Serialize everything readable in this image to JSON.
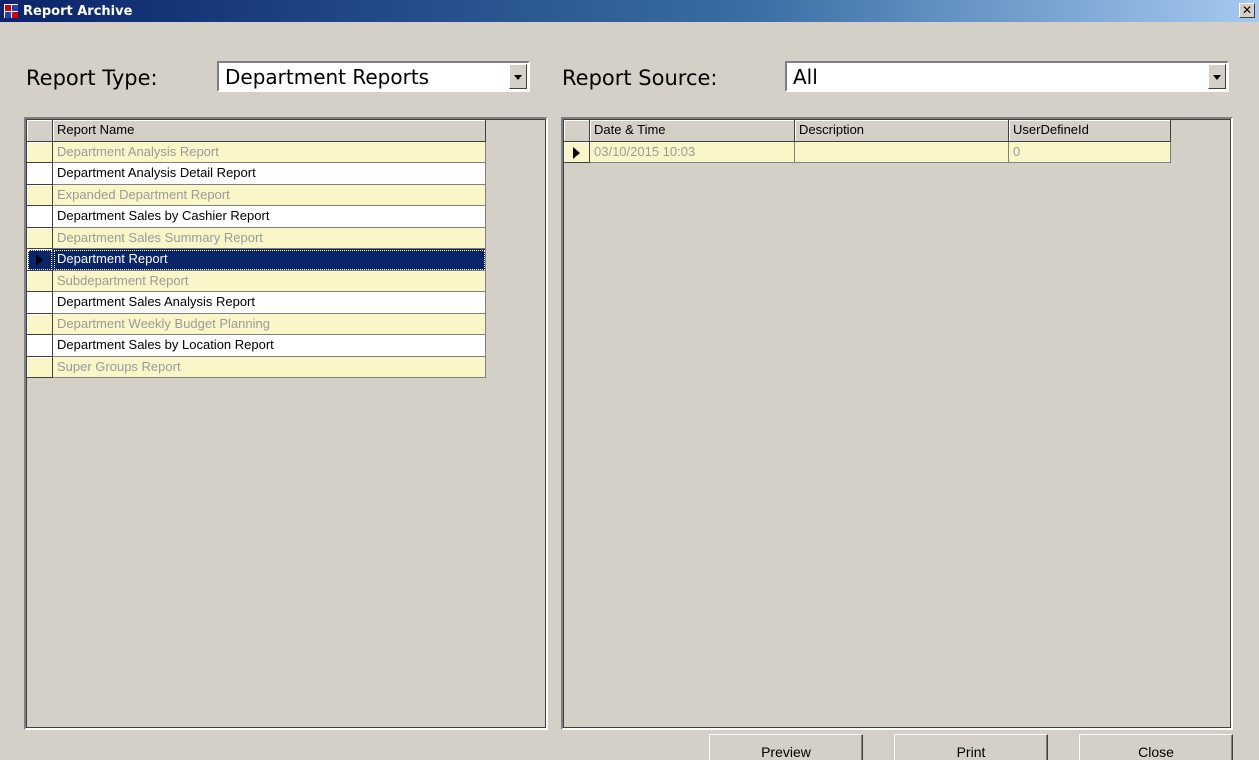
{
  "window": {
    "title": "Report Archive"
  },
  "filters": {
    "report_type_label": "Report Type:",
    "report_type_value": "Department Reports",
    "report_source_label": "Report Source:",
    "report_source_value": "All"
  },
  "reports_grid": {
    "header": "Report Name",
    "rows": [
      "Department Analysis Report",
      "Department Analysis Detail Report",
      "Expanded Department Report",
      "Department Sales by Cashier Report",
      "Department Sales Summary Report",
      "Department Report",
      "Subdepartment Report",
      "Department Sales Analysis Report",
      "Department Weekly Budget Planning",
      "Department Sales by Location Report",
      "Super Groups Report"
    ],
    "selected_index": 5
  },
  "archive_grid": {
    "headers": [
      "Date & Time",
      "Description",
      "UserDefineId"
    ],
    "rows": [
      [
        "03/10/2015 10:03",
        "",
        "0"
      ]
    ]
  },
  "buttons": {
    "preview": "Preview",
    "print": "Print",
    "close": "Close"
  },
  "colors": {
    "odd_row": "#fbf6c8",
    "selected_row": "#0a246a",
    "face": "#d4d0c8"
  }
}
